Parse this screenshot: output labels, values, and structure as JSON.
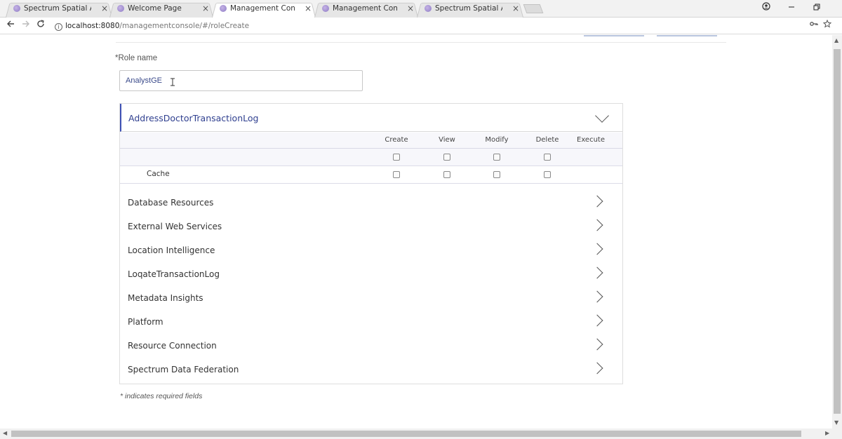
{
  "browser": {
    "tabs": [
      {
        "title": "Spectrum Spatial Analyst",
        "close": "×"
      },
      {
        "title": "Welcome Page",
        "close": "×"
      },
      {
        "title": "Management Console",
        "close": "×"
      },
      {
        "title": "Management Console",
        "close": "×"
      },
      {
        "title": "Spectrum Spatial Analyst",
        "close": "×"
      }
    ],
    "url_host": "localhost:8080",
    "url_path": "/managementconsole/#/roleCreate"
  },
  "form": {
    "role_label": "*Role name",
    "role_value": "AnalystGE",
    "footnote": "* indicates required fields"
  },
  "expanded_section": {
    "title": "AddressDoctorTransactionLog",
    "columns": [
      "Create",
      "View",
      "Modify",
      "Delete",
      "Execute"
    ],
    "rows": [
      {
        "label": ""
      },
      {
        "label": "Cache"
      }
    ]
  },
  "sections": [
    "Database Resources",
    "External Web Services",
    "Location Intelligence",
    "LoqateTransactionLog",
    "Metadata Insights",
    "Platform",
    "Resource Connection",
    "Spectrum Data Federation"
  ],
  "icons": {
    "back": "arrow-left-icon",
    "forward": "arrow-right-icon",
    "reload": "reload-icon",
    "info": "info-icon",
    "key": "key-icon",
    "star": "star-icon",
    "profile": "profile-icon",
    "chevron_down": "chevron-down-icon",
    "chevron_right": "chevron-right-icon"
  }
}
